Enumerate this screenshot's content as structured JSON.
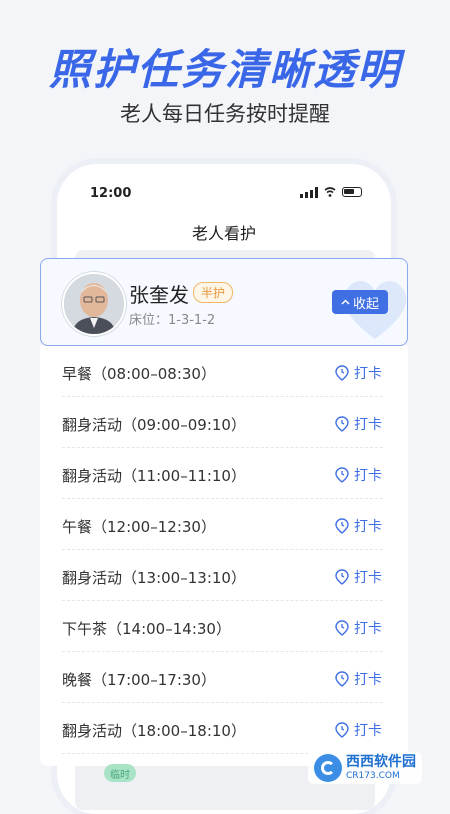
{
  "promo": {
    "headline": "照护任务清晰透明",
    "subline": "老人每日任务按时提醒"
  },
  "status_bar": {
    "time": "12:00"
  },
  "page": {
    "title": "老人看护"
  },
  "resident": {
    "name": "张奎发",
    "care_level": "半护",
    "bed": "床位：1-3-1-2",
    "collapse_label": "收起"
  },
  "tasks": [
    {
      "name": "早餐（08:00–08:30）",
      "action": "打卡"
    },
    {
      "name": "翻身活动（09:00–09:10）",
      "action": "打卡"
    },
    {
      "name": "翻身活动（11:00–11:10）",
      "action": "打卡"
    },
    {
      "name": "午餐（12:00–12:30）",
      "action": "打卡"
    },
    {
      "name": "翻身活动（13:00–13:10）",
      "action": "打卡"
    },
    {
      "name": "下午茶（14:00–14:30）",
      "action": "打卡"
    },
    {
      "name": "晚餐（17:00–17:30）",
      "action": "打卡"
    },
    {
      "name": "翻身活动（18:00–18:10）",
      "action": "打卡"
    }
  ],
  "floating_tag": "临时",
  "watermark": {
    "brand": "西西软件园",
    "domain": "CR173.COM"
  },
  "colors": {
    "accent": "#3f6fe3",
    "headline": "#3a67e8",
    "badge": "#e39a3b"
  }
}
